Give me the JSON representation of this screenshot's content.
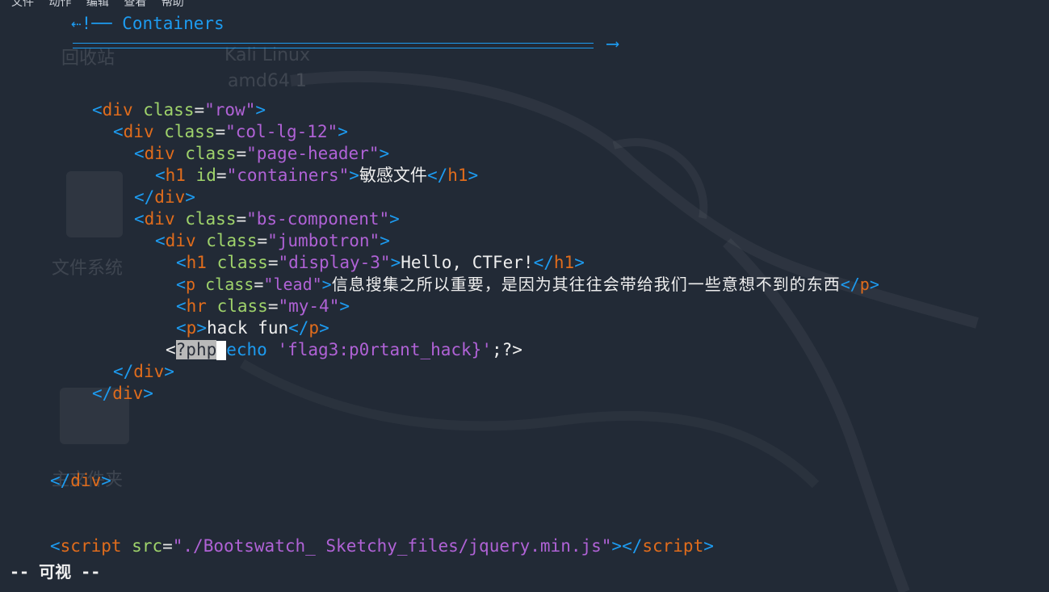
{
  "menubar": [
    "文件",
    "动作",
    "编辑",
    "查看",
    "帮助"
  ],
  "desktop": {
    "recycle_bin": "回收站",
    "kali_line1": "Kali Linux",
    "kali_line2": "amd64 1",
    "filesystem": "文件系统",
    "home_folder": "主文件夹"
  },
  "fold": {
    "label": "⇠!── Containers",
    "arrow": "⟶"
  },
  "code": {
    "l_row": "div",
    "l_row_attr": "class",
    "l_row_val": "\"row\"",
    "l_col": "div",
    "l_col_attr": "class",
    "l_col_val": "\"col-lg-12\"",
    "l_ph": "div",
    "l_ph_attr": "class",
    "l_ph_val": "\"page-header\"",
    "l_h1": "h1",
    "l_h1_attr": "id",
    "l_h1_val": "\"containers\"",
    "l_h1_text": "敏感文件",
    "l_div_close1": "div",
    "l_bs": "div",
    "l_bs_attr": "class",
    "l_bs_val": "\"bs-component\"",
    "l_jb": "div",
    "l_jb_attr": "class",
    "l_jb_val": "\"jumbotron\"",
    "l_d3": "h1",
    "l_d3_attr": "class",
    "l_d3_val": "\"display-3\"",
    "l_d3_text": "Hello, CTFer!",
    "l_p": "p",
    "l_p_attr": "class",
    "l_p_val": "\"lead\"",
    "l_p_text": "信息搜集之所以重要，是因为其往往会带给我们一些意想不到的东西",
    "l_hr": "hr",
    "l_hr_attr": "class",
    "l_hr_val": "\"my-4\"",
    "l_p2": "p",
    "l_p2_text": "hack fun",
    "php_open": "?php",
    "php_echo": "echo",
    "php_str": "'flag3:p0rtant_hack}'",
    "php_end": ";?>",
    "l_div_close2": "div",
    "l_div_close3": "div",
    "l_div_close4": "div",
    "script_tag": "script",
    "script_attr": "src",
    "script_val": "\"./Bootswatch_ Sketchy_files/jquery.min.js\""
  },
  "status": "-- 可视 --"
}
